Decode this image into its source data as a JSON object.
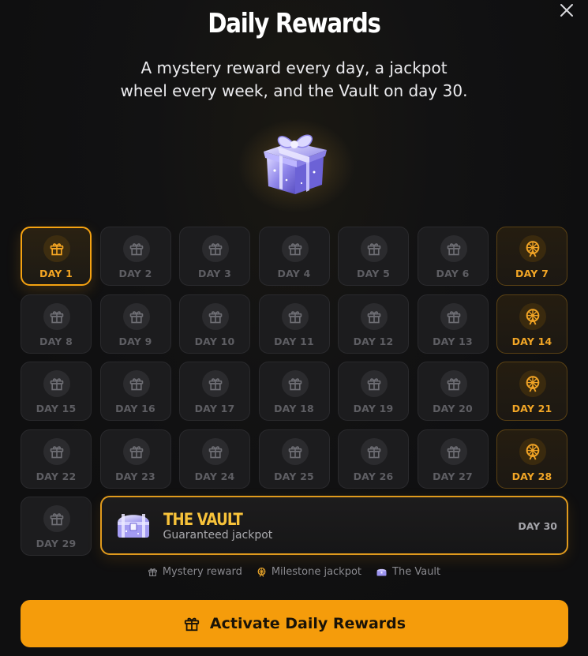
{
  "modal": {
    "title": "Daily Rewards",
    "subtitle": "A mystery reward every day, a jackpot wheel every week, and the Vault on day 30.",
    "close_icon": "close-icon"
  },
  "days": [
    {
      "label": "DAY 1",
      "state": "active",
      "icon": "gift-icon"
    },
    {
      "label": "DAY 2",
      "state": "locked",
      "icon": "gift-icon"
    },
    {
      "label": "DAY 3",
      "state": "locked",
      "icon": "gift-icon"
    },
    {
      "label": "DAY 4",
      "state": "locked",
      "icon": "gift-icon"
    },
    {
      "label": "DAY 5",
      "state": "locked",
      "icon": "gift-icon"
    },
    {
      "label": "DAY 6",
      "state": "locked",
      "icon": "gift-icon"
    },
    {
      "label": "DAY 7",
      "state": "milestone",
      "icon": "wheel-icon"
    },
    {
      "label": "DAY 8",
      "state": "locked",
      "icon": "gift-icon"
    },
    {
      "label": "DAY 9",
      "state": "locked",
      "icon": "gift-icon"
    },
    {
      "label": "DAY 10",
      "state": "locked",
      "icon": "gift-icon"
    },
    {
      "label": "DAY 11",
      "state": "locked",
      "icon": "gift-icon"
    },
    {
      "label": "DAY 12",
      "state": "locked",
      "icon": "gift-icon"
    },
    {
      "label": "DAY 13",
      "state": "locked",
      "icon": "gift-icon"
    },
    {
      "label": "DAY 14",
      "state": "milestone",
      "icon": "wheel-icon"
    },
    {
      "label": "DAY 15",
      "state": "locked",
      "icon": "gift-icon"
    },
    {
      "label": "DAY 16",
      "state": "locked",
      "icon": "gift-icon"
    },
    {
      "label": "DAY 17",
      "state": "locked",
      "icon": "gift-icon"
    },
    {
      "label": "DAY 18",
      "state": "locked",
      "icon": "gift-icon"
    },
    {
      "label": "DAY 19",
      "state": "locked",
      "icon": "gift-icon"
    },
    {
      "label": "DAY 20",
      "state": "locked",
      "icon": "gift-icon"
    },
    {
      "label": "DAY 21",
      "state": "milestone",
      "icon": "wheel-icon"
    },
    {
      "label": "DAY 22",
      "state": "locked",
      "icon": "gift-icon"
    },
    {
      "label": "DAY 23",
      "state": "locked",
      "icon": "gift-icon"
    },
    {
      "label": "DAY 24",
      "state": "locked",
      "icon": "gift-icon"
    },
    {
      "label": "DAY 25",
      "state": "locked",
      "icon": "gift-icon"
    },
    {
      "label": "DAY 26",
      "state": "locked",
      "icon": "gift-icon"
    },
    {
      "label": "DAY 27",
      "state": "locked",
      "icon": "gift-icon"
    },
    {
      "label": "DAY 28",
      "state": "milestone",
      "icon": "wheel-icon"
    },
    {
      "label": "DAY 29",
      "state": "locked",
      "icon": "gift-icon"
    }
  ],
  "vault": {
    "title": "THE VAULT",
    "subtitle": "Guaranteed jackpot",
    "day_label": "DAY 30",
    "icon": "chest-icon"
  },
  "legend": [
    {
      "label": "Mystery reward",
      "icon": "gift-icon"
    },
    {
      "label": "Milestone jackpot",
      "icon": "wheel-icon"
    },
    {
      "label": "The Vault",
      "icon": "chest-icon"
    }
  ],
  "cta": {
    "label": "Activate Daily Rewards",
    "icon": "gift-icon"
  },
  "colors": {
    "accent": "#f59c0b",
    "milestone": "#f2a626",
    "vault_title": "#f7c23a",
    "background": "#0f0f10",
    "tile": "#1c1c1e",
    "locked_text": "#5e5e63"
  }
}
